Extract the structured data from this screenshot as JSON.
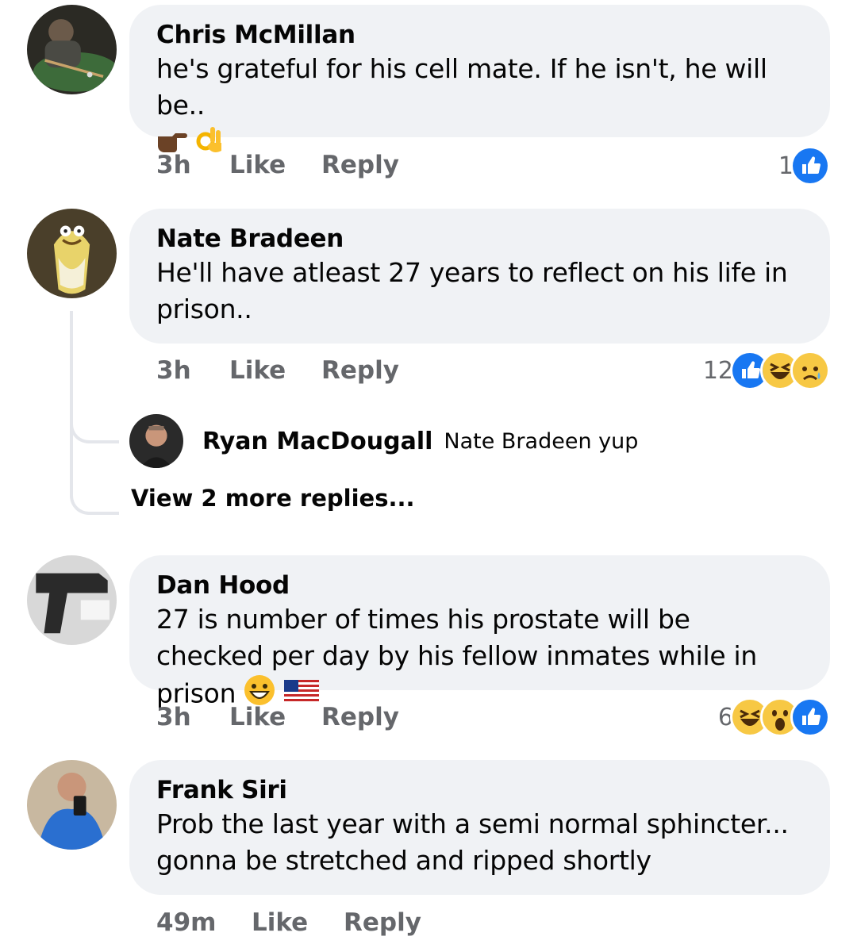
{
  "comments": [
    {
      "author": "Chris McMillan",
      "text": "he's grateful for his cell mate. If he isn't, he will be..",
      "emojis": [
        "pointing-right-emoji",
        "ok-hand-emoji"
      ],
      "time": "3h",
      "like_label": "Like",
      "reply_label": "Reply",
      "reaction_count": "1",
      "reactions": [
        "like"
      ]
    },
    {
      "author": "Nate Bradeen",
      "text": "He'll have atleast 27 years to reflect on his life in prison..",
      "time": "3h",
      "like_label": "Like",
      "reply_label": "Reply",
      "reaction_count": "12",
      "reactions": [
        "like",
        "haha",
        "sad"
      ],
      "reply_preview": {
        "author": "Ryan MacDougall",
        "text": "Nate Bradeen yup"
      },
      "view_more": "View 2 more replies..."
    },
    {
      "author": "Dan Hood",
      "text": "27 is number of times his prostate will be checked per day by his fellow inmates while in prison",
      "emojis": [
        "grinning-emoji",
        "us-flag-emoji"
      ],
      "time": "3h",
      "like_label": "Like",
      "reply_label": "Reply",
      "reaction_count": "6",
      "reactions": [
        "haha",
        "wow",
        "like"
      ]
    },
    {
      "author": "Frank Siri",
      "text": "Prob the last year with a semi normal sphincter... gonna be stretched and ripped shortly",
      "time": "49m",
      "like_label": "Like",
      "reply_label": "Reply"
    }
  ],
  "colors": {
    "bubble": "#f0f2f5",
    "meta": "#65676b",
    "like_blue": "#1877f2",
    "haha_yellow": "#f7c844",
    "thread_line": "#e4e6eb"
  }
}
